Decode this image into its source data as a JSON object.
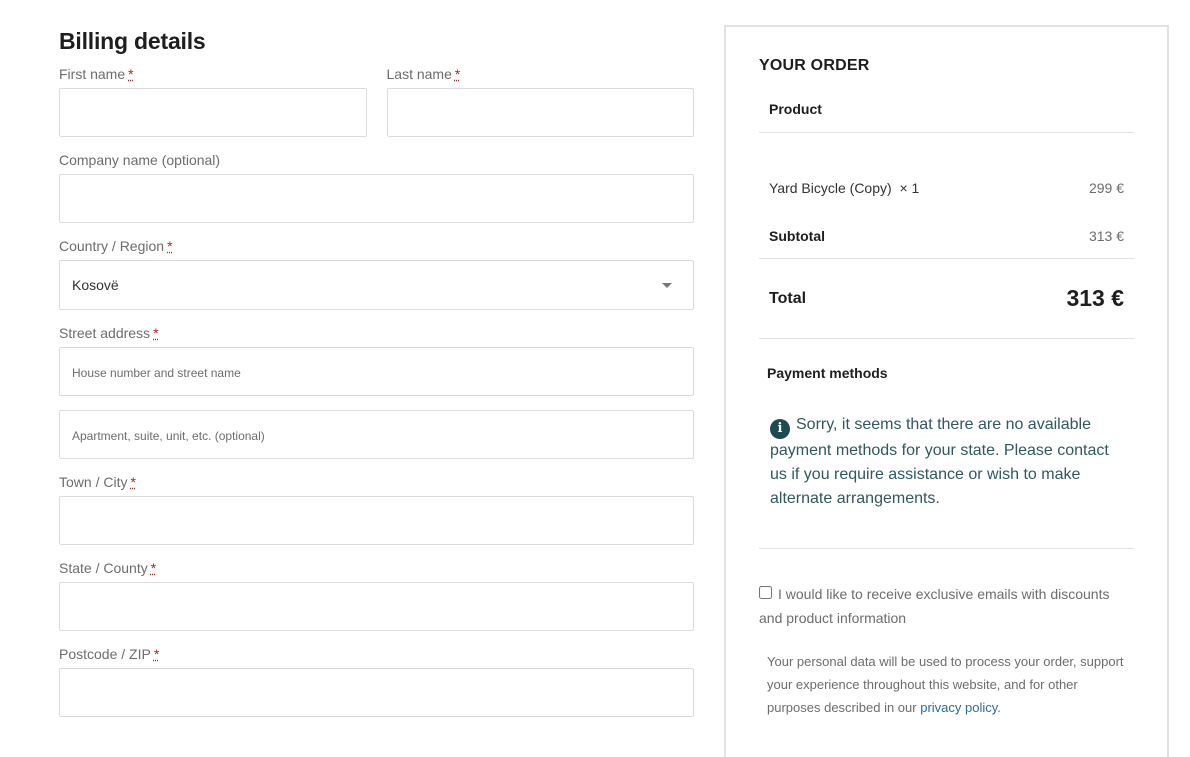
{
  "billing": {
    "title": "Billing details",
    "required_mark": "*",
    "first_name": {
      "label": "First name",
      "value": ""
    },
    "last_name": {
      "label": "Last name",
      "value": ""
    },
    "company": {
      "label": "Company name (optional)",
      "value": ""
    },
    "country": {
      "label": "Country / Region",
      "selected": "Kosovë"
    },
    "street": {
      "label": "Street address",
      "placeholder_1": "House number and street name",
      "placeholder_2": "Apartment, suite, unit, etc. (optional)"
    },
    "city": {
      "label": "Town / City",
      "value": ""
    },
    "state": {
      "label": "State / County",
      "value": ""
    },
    "postcode": {
      "label": "Postcode / ZIP",
      "value": ""
    }
  },
  "order": {
    "title": "YOUR ORDER",
    "product_header": "Product",
    "item": {
      "name": "Yard Bicycle (Copy)",
      "qty": "× 1",
      "price": "299 €"
    },
    "subtotal": {
      "label": "Subtotal",
      "value": "313 €"
    },
    "total": {
      "label": "Total",
      "value": "313 €"
    },
    "payment": {
      "title": "Payment methods",
      "icon": "info-icon",
      "notice": "Sorry, it seems that there are no available payment methods for your state. Please contact us if you require assistance or wish to make alternate arrangements."
    },
    "consent_label": "I would like to receive exclusive emails with discounts and product information",
    "privacy_text": "Your personal data will be used to process your order, support your experience throughout this website, and for other purposes described in our",
    "privacy_link": "privacy policy",
    "privacy_end": "."
  }
}
